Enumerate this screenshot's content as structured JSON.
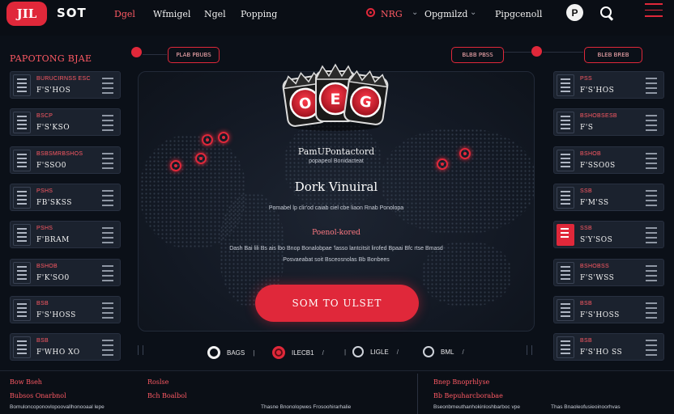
{
  "header": {
    "logo": "JIL",
    "brand": "SOT",
    "nav": [
      "Dgel",
      "Wfmigel",
      "Ngel",
      "Popping"
    ],
    "live_label": "NRG",
    "dropdown_1": "Opgmilzd",
    "dropdown_2": "Pipgcenoll",
    "profile_initial": "P"
  },
  "promo": {
    "title": "PAPOTONG BJAE",
    "pill_left": "PLAB PBUBS",
    "pill_mid": "BLBB PBSS",
    "pill_right": "BLEB BREB"
  },
  "cards_left": [
    {
      "name": "BURUCIRNSS ESC",
      "value": "F'S'HOS"
    },
    {
      "name": "BSCP",
      "value": "F'S'KSO"
    },
    {
      "name": "BSBSMRBSHOS",
      "value": "F'SSO0"
    },
    {
      "name": "PSHS",
      "value": "FB'SKSS"
    },
    {
      "name": "PSHS",
      "value": "F'BRAM"
    },
    {
      "name": "BSHOB",
      "value": "F'K'SO0"
    },
    {
      "name": "BSB",
      "value": "F'S'HOSS"
    },
    {
      "name": "BSB",
      "value": "F'WHO XO"
    }
  ],
  "cards_right": [
    {
      "name": "PSS",
      "value": "F'S'HOS"
    },
    {
      "name": "BSHOBSESB",
      "value": "F'S"
    },
    {
      "name": "BSHOB",
      "value": "F'SSO0S"
    },
    {
      "name": "SSB",
      "value": "F'M'SS"
    },
    {
      "name": "SSB",
      "value": "S'Y'SOS"
    },
    {
      "name": "BSHOBSS",
      "value": "F'S'WSS"
    },
    {
      "name": "BSB",
      "value": "F'S'HOSS"
    },
    {
      "name": "BSB",
      "value": "F'S'HO SS"
    }
  ],
  "hero": {
    "chip_letters": [
      "O",
      "E",
      "G"
    ],
    "headline": "PamUPontactord",
    "subline": "popapeol Bonidacteat",
    "title": "Dork Vinuiral",
    "desc": "Pomabel lp clir'od caiab ciel cbe liaon Rnab Ponolopa",
    "section": "Poenol-kored",
    "body_1": "Dash Bai lili Bs ais lbo Bnop Bonalobpae 'lasso lantcitsit lirofed Bpaai Bfc rtse Bmasd",
    "body_2": "Posvaeabat soit Bsceosnolas Bb Bonbees",
    "cta": "SOM TO ULSET"
  },
  "status": [
    {
      "label": "BAGS",
      "style": "white"
    },
    {
      "label": "ILECB1",
      "style": "red"
    },
    {
      "label": "LIGLE",
      "style": "gray"
    },
    {
      "label": "BML",
      "style": "white"
    }
  ],
  "footer": {
    "col1_title": "Bow Bseh",
    "col1_sub": "Bubsos Onarbnol",
    "col1_small": "Bomuloncoponovlopoovallhonooaal lepe",
    "col2_title": "Roslse",
    "col2_sub": "Bch Boalbol",
    "col2_small": "Thasne Bnonolopwes Frosoohirarhalie",
    "col3_title": "Bnep Bnoprhlyse",
    "col3_sub": "Bb Bepuharcborabae",
    "col3_small": "Bseonbmeuthanhokinloshbarboc vpe",
    "col4_small": "Thas Bnaoleofusieoinoorhvas"
  },
  "colors": {
    "accent": "#e0283a",
    "bg": "#0b1018",
    "card": "#1b222e"
  }
}
